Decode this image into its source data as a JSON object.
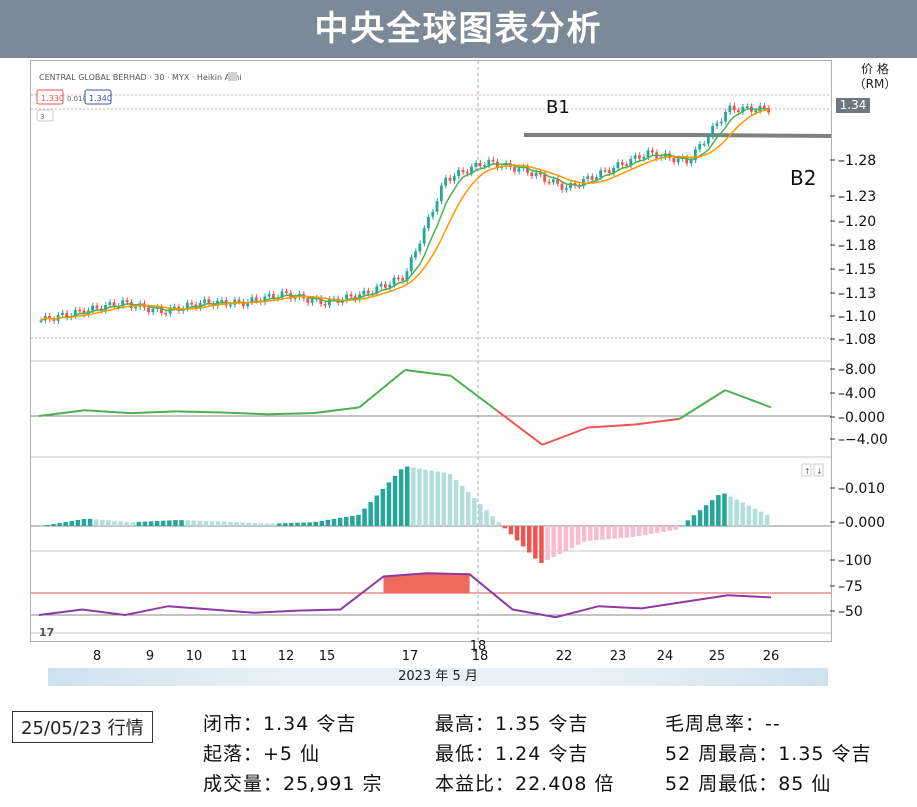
{
  "header": {
    "title": "中央全球图表分析"
  },
  "chart_header": {
    "symbol": "CENTRAL GLOBAL BERHAD · 30 · MYX · Heikin Ashi",
    "ohlc_badge_1": "1.330",
    "ohlc_badge_2": "0.010",
    "ohlc_badge_3": "1.340",
    "collapse": "3"
  },
  "axis": {
    "price_title_1": "价 格",
    "price_title_2": "（RM）",
    "last_price": "1.34",
    "price_ticks": [
      "1.28",
      "1.23",
      "1.20",
      "1.18",
      "1.15",
      "1.13",
      "1.10",
      "1.08"
    ],
    "macd_ticks": [
      "8.00",
      "4.00",
      "0.000",
      "−4.00"
    ],
    "hist_ticks": [
      "0.010",
      "0.000"
    ],
    "rsi_ticks": [
      "100",
      "75",
      "50"
    ],
    "x_ticks": [
      "8",
      "9",
      "10",
      "11",
      "12",
      "15",
      "17",
      "18",
      "22",
      "23",
      "24",
      "25",
      "26"
    ],
    "x_cursor_label": "18",
    "date_strip": "2023 年 5 月"
  },
  "annotations": {
    "b1": "B1",
    "b2": "B2"
  },
  "colors": {
    "up": "#26a69a",
    "down": "#ef5350",
    "ma_fast": "#4caf50",
    "ma_slow": "#ff9800",
    "macd": "#4caf50",
    "rsi": "#8e3aa6",
    "title_bar": "#7b8a96"
  },
  "chart_data": {
    "type": "candlestick",
    "title": "中央全球图表分析",
    "symbol": "CENTRAL GLOBAL BERHAD · 30 · MYX · Heikin Ashi",
    "x_dates": [
      "8",
      "9",
      "10",
      "11",
      "12",
      "15",
      "17",
      "18",
      "22",
      "23",
      "24",
      "25",
      "26"
    ],
    "price_range": [
      1.06,
      1.36
    ],
    "price_close_series": [
      1.1,
      1.11,
      1.12,
      1.11,
      1.12,
      1.12,
      1.13,
      1.12,
      1.13,
      1.15,
      1.26,
      1.28,
      1.27,
      1.25,
      1.27,
      1.29,
      1.28,
      1.34,
      1.34
    ],
    "resistance_levels": [
      {
        "name": "B1",
        "value": 1.305
      },
      {
        "name": "B2",
        "value": 1.305
      }
    ],
    "macd_range": [
      -6,
      10
    ],
    "macd_series": [
      0,
      1,
      0.5,
      0.8,
      0.6,
      0.3,
      0.5,
      1.5,
      8.0,
      7.0,
      1.0,
      -5.0,
      -2.0,
      -1.5,
      -0.5,
      4.5,
      1.5
    ],
    "histogram_range": [
      -0.004,
      0.012
    ],
    "rsi_range": [
      35,
      105
    ],
    "rsi_series": [
      50,
      55,
      50,
      58,
      55,
      52,
      54,
      55,
      85,
      88,
      87,
      55,
      48,
      58,
      56,
      62,
      68,
      66
    ],
    "rsi_levels": [
      70,
      50
    ]
  },
  "info": {
    "date": "25/05/23 行情",
    "close": "闭市：1.34 令吉",
    "high": "最高：1.35 令吉",
    "div": "毛周息率：--",
    "change": "起落：+5 仙",
    "low": "最低：1.24 令吉",
    "high52": "52 周最高：1.35 令吉",
    "volume": "成交量：25,991 宗",
    "pe": "本益比：22.408 倍",
    "low52": "52 周最低：85 仙"
  }
}
